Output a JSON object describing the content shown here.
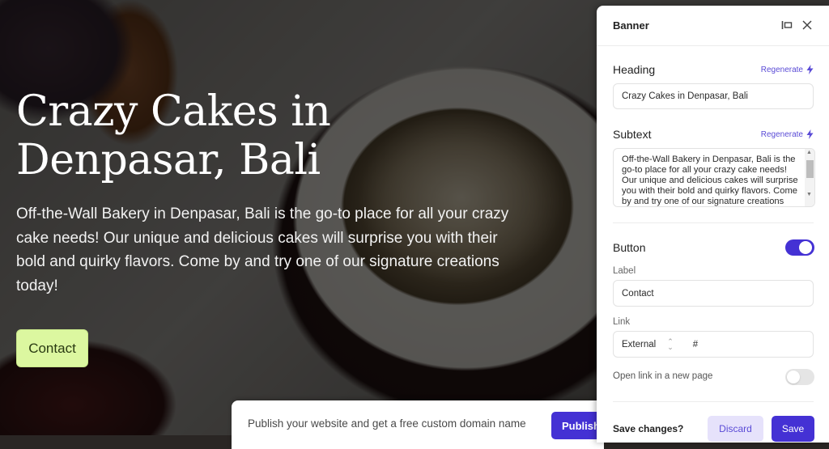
{
  "hero": {
    "title": "Crazy Cakes in Denpasar, Bali",
    "subtext": "Off-the-Wall Bakery in Denpasar, Bali is the go-to place for all your crazy cake needs! Our unique and delicious cakes will surprise you with their bold and quirky flavors. Come by and try one of our signature creations today!",
    "button_label": "Contact",
    "button_color": "#dcf7a0"
  },
  "publish_bar": {
    "text": "Publish your website and get a free custom domain name",
    "button_label": "Publish"
  },
  "panel": {
    "title": "Banner",
    "icons": [
      "dock-panel-icon",
      "close-icon"
    ],
    "heading": {
      "label": "Heading",
      "regenerate_label": "Regenerate",
      "value": "Crazy Cakes in Denpasar, Bali"
    },
    "subtext": {
      "label": "Subtext",
      "regenerate_label": "Regenerate",
      "value": "Off-the-Wall Bakery in Denpasar, Bali is the go-to place for all your crazy cake needs! Our unique and delicious cakes will surprise you with their bold and quirky flavors. Come by and try one of our signature creations today!"
    },
    "button_section": {
      "label": "Button",
      "enabled": true,
      "label_field_label": "Label",
      "label_value": "Contact",
      "link_field_label": "Link",
      "link_type": "External",
      "link_value": "#",
      "new_page_label": "Open link in a new page",
      "new_page_enabled": false
    },
    "footer": {
      "prompt": "Save changes?",
      "discard_label": "Discard",
      "save_label": "Save"
    }
  },
  "colors": {
    "accent": "#4431d4",
    "accent_light": "#e6e2fb",
    "regenerate": "#5a4bd6"
  }
}
